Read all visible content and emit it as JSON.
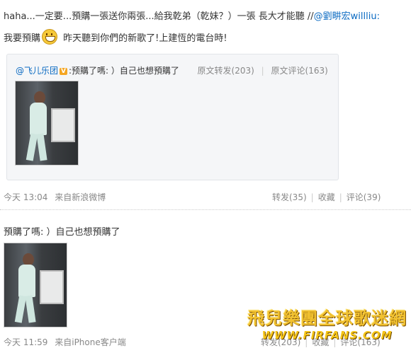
{
  "post": {
    "text_part1": "haha...一定要...預購一張送你兩張...給我乾弟（乾妹？）一張  長大才能聽  //",
    "mention": "@劉畊宏willliu:",
    "text_part2a": "我要預購",
    "emoji_icon": "grin-emoji-icon",
    "text_part2b": " 昨天聽到你們的新歌了!上建恆的電台時!"
  },
  "repost": {
    "author": "@飞儿乐团",
    "verified_badge": "V",
    "text": ":预購了嗎: ）自己也想預購了",
    "repost_label": "原文转发(203)",
    "comment_label": "原文评论(163)"
  },
  "meta1": {
    "time": "今天  13:04",
    "source": "来自新浪微博",
    "repost": "转发(35)",
    "favorite": "收藏",
    "comment": "评论(39)"
  },
  "post2": {
    "text": "預購了嗎: ）自己也想預購了"
  },
  "meta2": {
    "time": "今天  11:59",
    "source": "来自iPhone客户端",
    "repost": "转发(203)",
    "favorite": "收藏",
    "comment": "评论(163)"
  },
  "watermark": {
    "top": "飛兒樂團全球歌迷網",
    "bottom": "WWW.FIRFANS.COM"
  },
  "colors": {
    "link": "#0a6ac2",
    "repost_bg": "#f5f6f8",
    "watermark": "#f2c230"
  }
}
